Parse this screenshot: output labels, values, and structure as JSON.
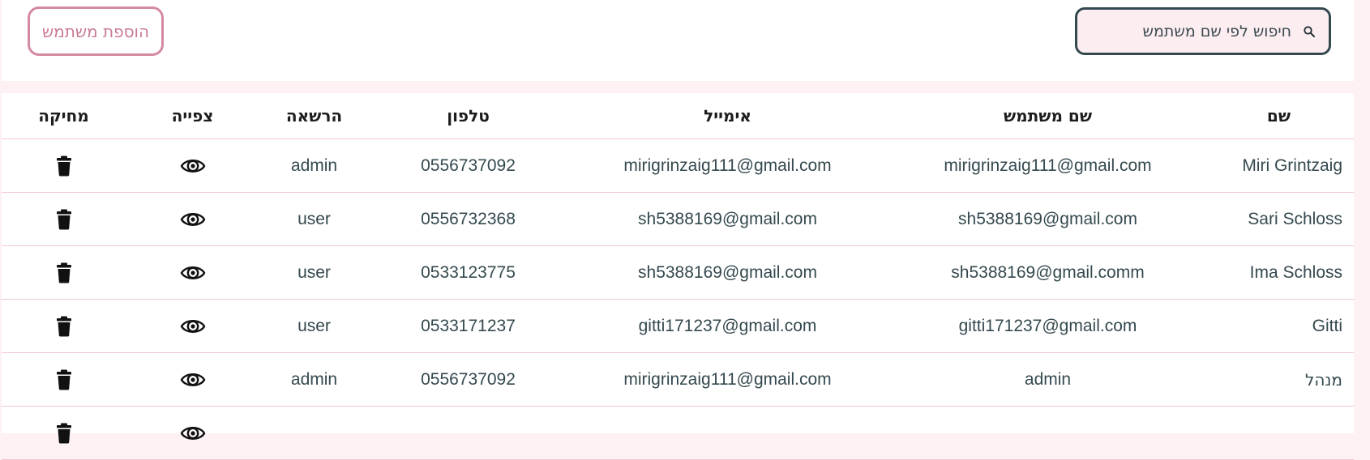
{
  "toolbar": {
    "add_user_label": "הוספת משתמש",
    "search_placeholder": "חיפוש לפי שם משתמש",
    "search_value": ""
  },
  "table": {
    "columns": [
      "שם",
      "שם משתמש",
      "אימייל",
      "טלפון",
      "הרשאה",
      "צפייה",
      "מחיקה"
    ],
    "rows": [
      {
        "name": "Miri Grintzaig",
        "username": "mirigrinzaig111@gmail.com",
        "email": "mirigrinzaig111@gmail.com",
        "phone": "0556737092",
        "role": "admin"
      },
      {
        "name": "Sari Schloss",
        "username": "sh5388169@gmail.com",
        "email": "sh5388169@gmail.com",
        "phone": "0556732368",
        "role": "user"
      },
      {
        "name": "Ima Schloss",
        "username": "sh5388169@gmail.comm",
        "email": "sh5388169@gmail.com",
        "phone": "0533123775",
        "role": "user"
      },
      {
        "name": "Gitti",
        "username": "gitti171237@gmail.com",
        "email": "gitti171237@gmail.com",
        "phone": "0533171237",
        "role": "user"
      },
      {
        "name": "מנהל",
        "username": "admin",
        "email": "mirigrinzaig111@gmail.com",
        "phone": "0556737092",
        "role": "admin"
      }
    ]
  },
  "colors": {
    "accent_pink": "#d48a9f",
    "page_bg": "#fdf1f4",
    "row_divider": "#f2c6d2",
    "search_border": "#34494f"
  },
  "icons": {
    "search": "search-icon",
    "view": "eye-icon",
    "delete": "trash-icon"
  }
}
